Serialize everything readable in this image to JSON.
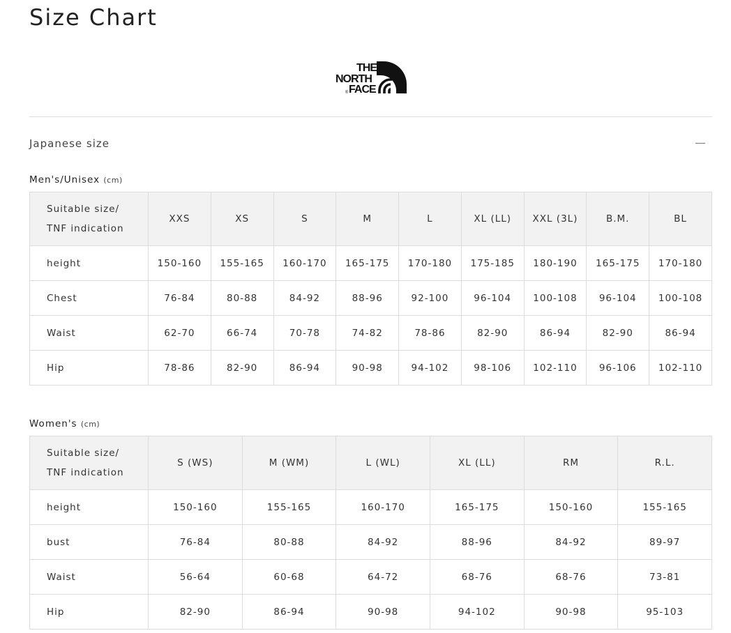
{
  "page": {
    "title": "Size Chart",
    "brand_logo": {
      "lines": [
        "THE",
        "NORTH",
        "FACE"
      ],
      "registered_mark": "®"
    }
  },
  "accordion": {
    "label": "Japanese size",
    "expanded": true,
    "toggle_icon": "minus-icon"
  },
  "mens": {
    "heading": "Men's/Unisex",
    "unit": "(cm)",
    "header_label_1": "Suitable size/",
    "header_label_2": "TNF indication",
    "sizes": [
      "XXS",
      "XS",
      "S",
      "M",
      "L",
      "XL (LL)",
      "XXL (3L)",
      "B.M.",
      "BL"
    ],
    "rows": [
      {
        "label": "height",
        "values": [
          "150-160",
          "155-165",
          "160-170",
          "165-175",
          "170-180",
          "175-185",
          "180-190",
          "165-175",
          "170-180"
        ]
      },
      {
        "label": "Chest",
        "values": [
          "76-84",
          "80-88",
          "84-92",
          "88-96",
          "92-100",
          "96-104",
          "100-108",
          "96-104",
          "100-108"
        ]
      },
      {
        "label": "Waist",
        "values": [
          "62-70",
          "66-74",
          "70-78",
          "74-82",
          "78-86",
          "82-90",
          "86-94",
          "82-90",
          "86-94"
        ]
      },
      {
        "label": "Hip",
        "values": [
          "78-86",
          "82-90",
          "86-94",
          "90-98",
          "94-102",
          "98-106",
          "102-110",
          "96-106",
          "102-110"
        ]
      }
    ]
  },
  "womens": {
    "heading": "Women's",
    "unit": "(cm)",
    "header_label_1": "Suitable size/",
    "header_label_2": "TNF indication",
    "sizes": [
      "S (WS)",
      "M (WM)",
      "L (WL)",
      "XL (LL)",
      "RM",
      "R.L."
    ],
    "rows": [
      {
        "label": "height",
        "values": [
          "150-160",
          "155-165",
          "160-170",
          "165-175",
          "150-160",
          "155-165"
        ]
      },
      {
        "label": "bust",
        "values": [
          "76-84",
          "80-88",
          "84-92",
          "88-96",
          "84-92",
          "89-97"
        ]
      },
      {
        "label": "Waist",
        "values": [
          "56-64",
          "60-68",
          "64-72",
          "68-76",
          "68-76",
          "73-81"
        ]
      },
      {
        "label": "Hip",
        "values": [
          "82-90",
          "86-94",
          "90-98",
          "94-102",
          "90-98",
          "95-103"
        ]
      }
    ]
  }
}
